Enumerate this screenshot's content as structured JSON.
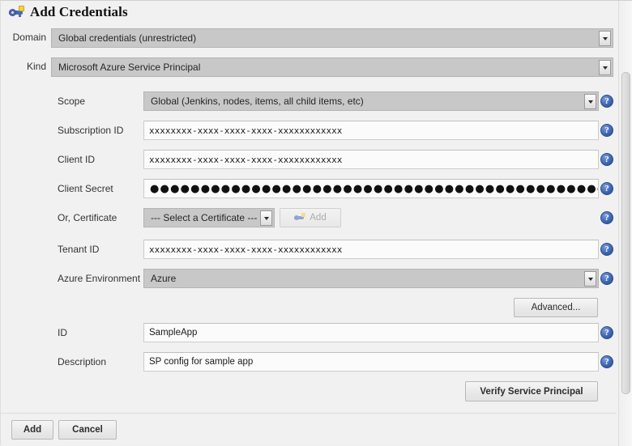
{
  "window": {
    "title": "Add Credentials",
    "title_icon": "key-icon"
  },
  "domain_row": {
    "label": "Domain",
    "value": "Global credentials (unrestricted)"
  },
  "kind_row": {
    "label": "Kind",
    "value": "Microsoft Azure Service Principal"
  },
  "fields": {
    "scope": {
      "label": "Scope",
      "value": "Global (Jenkins, nodes, items, all child items, etc)"
    },
    "subscription_id": {
      "label": "Subscription ID",
      "value": "xxxxxxxx-xxxx-xxxx-xxxx-xxxxxxxxxxxx"
    },
    "client_id": {
      "label": "Client ID",
      "value": "xxxxxxxx-xxxx-xxxx-xxxx-xxxxxxxxxxxx"
    },
    "client_secret": {
      "label": "Client Secret",
      "value": "●●●●●●●●●●●●●●●●●●●●●●●●●●●●●●●●●●●●●●●●●●●●●●"
    },
    "certificate": {
      "label": "Or, Certificate",
      "value": "--- Select a Certificate ---",
      "add_button": "Add"
    },
    "tenant_id": {
      "label": "Tenant ID",
      "value": "xxxxxxxx-xxxx-xxxx-xxxx-xxxxxxxxxxxx"
    },
    "azure_environment": {
      "label": "Azure Environment",
      "value": "Azure"
    },
    "id": {
      "label": "ID",
      "value": "SampleApp"
    },
    "description": {
      "label": "Description",
      "value": "SP config for sample app"
    }
  },
  "buttons": {
    "advanced": "Advanced...",
    "verify": "Verify Service Principal",
    "add": "Add",
    "cancel": "Cancel"
  },
  "help": {
    "glyph": "?"
  },
  "colors": {
    "background": "#f1f1f1",
    "select_fill": "#c8c8c8",
    "input_fill": "#fbfbfb",
    "help_blue": "#3a63ae",
    "key_blue": "#4a69b5",
    "key_yellow": "#f6d33c"
  }
}
